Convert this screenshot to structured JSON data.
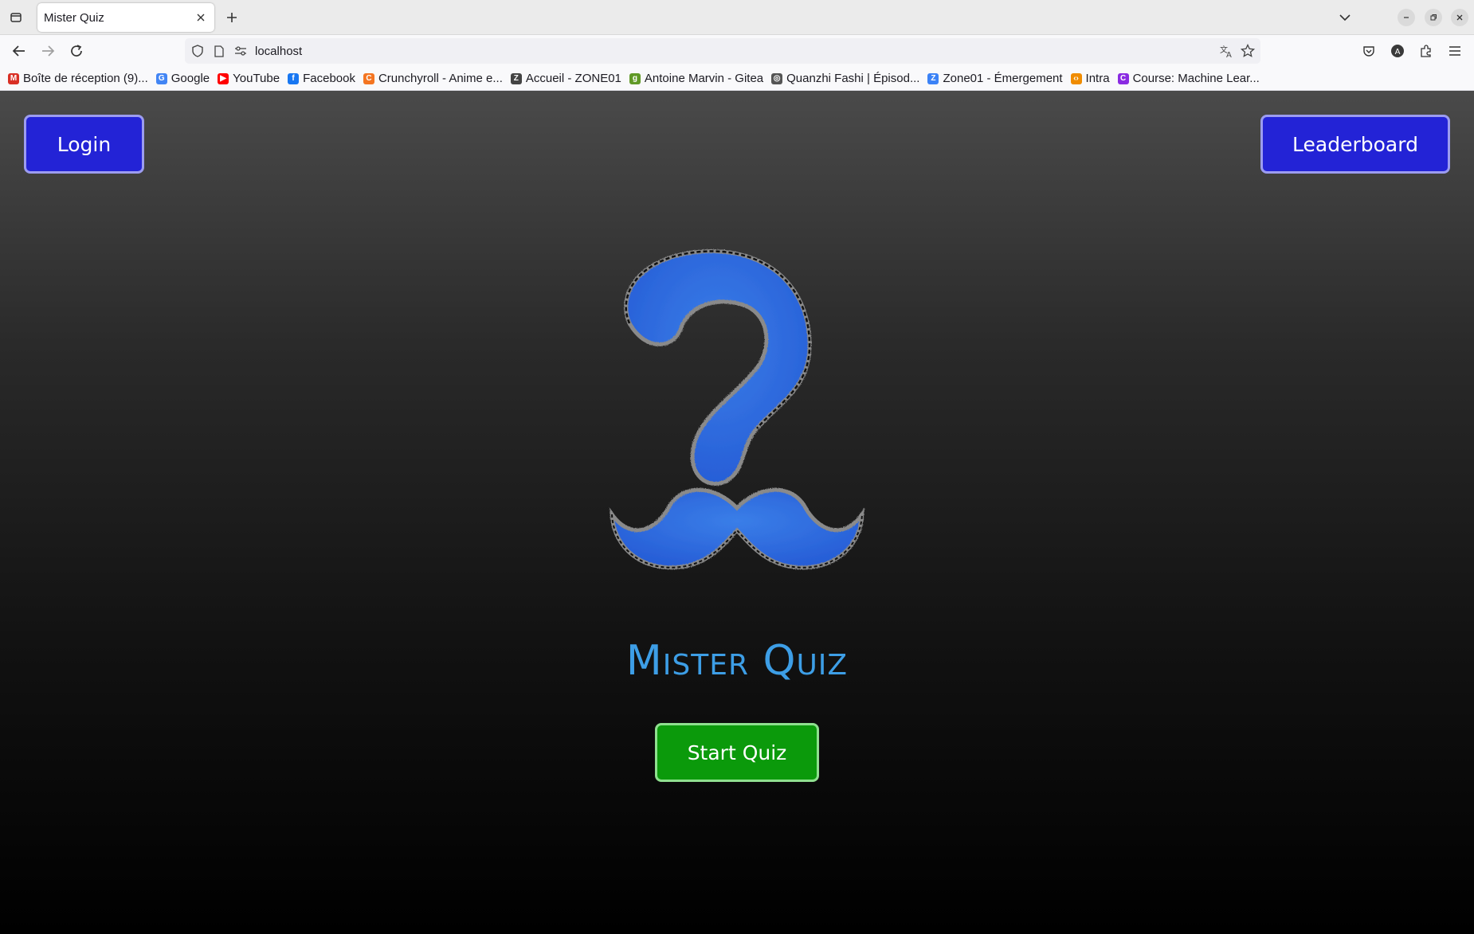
{
  "browser": {
    "tab_title": "Mister Quiz",
    "url": "localhost",
    "bookmarks": [
      {
        "label": "Boîte de réception (9)...",
        "icon": "gmail-icon",
        "color": "#d93025",
        "glyph": "M"
      },
      {
        "label": "Google",
        "icon": "google-icon",
        "color": "#4285f4",
        "glyph": "G"
      },
      {
        "label": "YouTube",
        "icon": "youtube-icon",
        "color": "#ff0000",
        "glyph": "▶"
      },
      {
        "label": "Facebook",
        "icon": "facebook-icon",
        "color": "#1877f2",
        "glyph": "f"
      },
      {
        "label": "Crunchyroll - Anime e...",
        "icon": "crunchyroll-icon",
        "color": "#f47521",
        "glyph": "C"
      },
      {
        "label": "Accueil - ZONE01",
        "icon": "zone01-icon",
        "color": "#444444",
        "glyph": "Z"
      },
      {
        "label": "Antoine Marvin - Gitea",
        "icon": "gitea-icon",
        "color": "#609926",
        "glyph": "g"
      },
      {
        "label": "Quanzhi Fashi | Épisod...",
        "icon": "globe-icon",
        "color": "#555555",
        "glyph": "◎"
      },
      {
        "label": "Zone01 - Émergement",
        "icon": "zone01-emargement-icon",
        "color": "#3b82f6",
        "glyph": "Z"
      },
      {
        "label": "Intra",
        "icon": "code-icon",
        "color": "#f08c00",
        "glyph": "‹›"
      },
      {
        "label": "Course: Machine Lear...",
        "icon": "course-icon",
        "color": "#8a2be2",
        "glyph": "C"
      }
    ]
  },
  "page": {
    "login_label": "Login",
    "leaderboard_label": "Leaderboard",
    "title": "Mister Quiz",
    "start_label": "Start Quiz",
    "logo_icon": "question-mark-mustache-logo"
  },
  "colors": {
    "blue_button": "#2323d6",
    "green_button": "#0b9a0b",
    "title": "#3d9ee6",
    "logo_blue": "#2f6fe0"
  }
}
